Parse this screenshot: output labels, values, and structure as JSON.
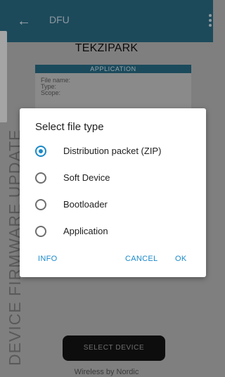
{
  "appbar": {
    "back_icon": "back-arrow-icon",
    "title": "DFU",
    "menu_icon": "more-vert-icon"
  },
  "device": {
    "name": "TEKZIPARK"
  },
  "app_card": {
    "header": "APPLICATION",
    "rows": [
      "File name:",
      "Type:",
      "Scope:"
    ]
  },
  "side_text": "DEVICE FIRMWARE UPDATE",
  "select_device_label": "SELECT DEVICE",
  "footer": "Wireless by Nordic",
  "dialog": {
    "title": "Select file type",
    "options": [
      {
        "label": "Distribution packet (ZIP)",
        "selected": true
      },
      {
        "label": "Soft Device",
        "selected": false
      },
      {
        "label": "Bootloader",
        "selected": false
      },
      {
        "label": "Application",
        "selected": false
      }
    ],
    "info_label": "INFO",
    "cancel_label": "CANCEL",
    "ok_label": "OK"
  },
  "colors": {
    "accent": "#1a89c9",
    "appbar": "#1d4a5b"
  }
}
